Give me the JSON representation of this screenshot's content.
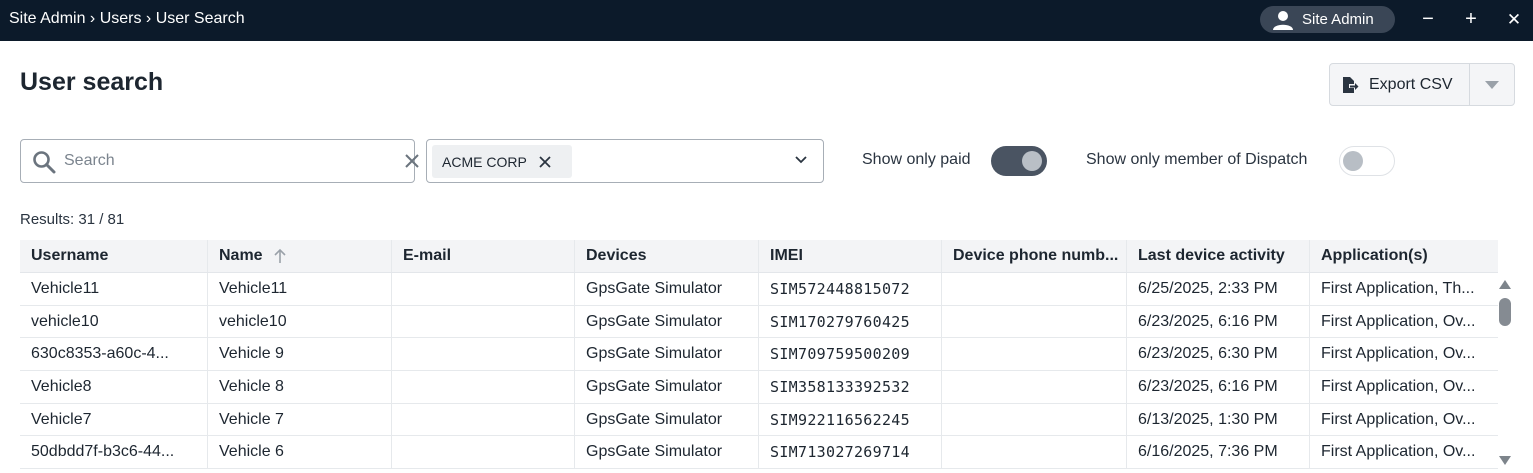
{
  "titlebar": {
    "breadcrumb": "Site Admin › Users › User Search",
    "user_label": "Site Admin",
    "minimize": "−",
    "maximize": "+",
    "close": "✕"
  },
  "page": {
    "title": "User search",
    "export_label": "Export CSV"
  },
  "filters": {
    "search_placeholder": "Search",
    "search_value": "",
    "selected_tag": "ACME CORP",
    "toggle_paid_label": "Show only paid",
    "toggle_paid_on": true,
    "toggle_dispatch_label": "Show only member of Dispatch",
    "toggle_dispatch_on": false
  },
  "results": {
    "text": "Results: 31 / 81"
  },
  "table": {
    "columns": [
      "Username",
      "Name",
      "E-mail",
      "Devices",
      "IMEI",
      "Device phone numb...",
      "Last device activity",
      "Application(s)"
    ],
    "sort_column": "Name",
    "rows": [
      [
        "Vehicle11",
        "Vehicle11",
        "",
        "GpsGate Simulator",
        "SIM572448815072",
        "",
        "6/25/2025, 2:33 PM",
        "First Application, Th..."
      ],
      [
        "vehicle10",
        "vehicle10",
        "",
        "GpsGate Simulator",
        "SIM170279760425",
        "",
        "6/23/2025, 6:16 PM",
        "First Application, Ov..."
      ],
      [
        "630c8353-a60c-4...",
        "Vehicle 9",
        "",
        "GpsGate Simulator",
        "SIM709759500209",
        "",
        "6/23/2025, 6:30 PM",
        "First Application, Ov..."
      ],
      [
        "Vehicle8",
        "Vehicle 8",
        "",
        "GpsGate Simulator",
        "SIM358133392532",
        "",
        "6/23/2025, 6:16 PM",
        "First Application, Ov..."
      ],
      [
        "Vehicle7",
        "Vehicle 7",
        "",
        "GpsGate Simulator",
        "SIM922116562245",
        "",
        "6/13/2025, 1:30 PM",
        "First Application, Ov..."
      ],
      [
        "50dbdd7f-b3c6-44...",
        "Vehicle 6",
        "",
        "GpsGate Simulator",
        "SIM713027269714",
        "",
        "6/16/2025, 7:36 PM",
        "First Application, Ov..."
      ]
    ]
  }
}
